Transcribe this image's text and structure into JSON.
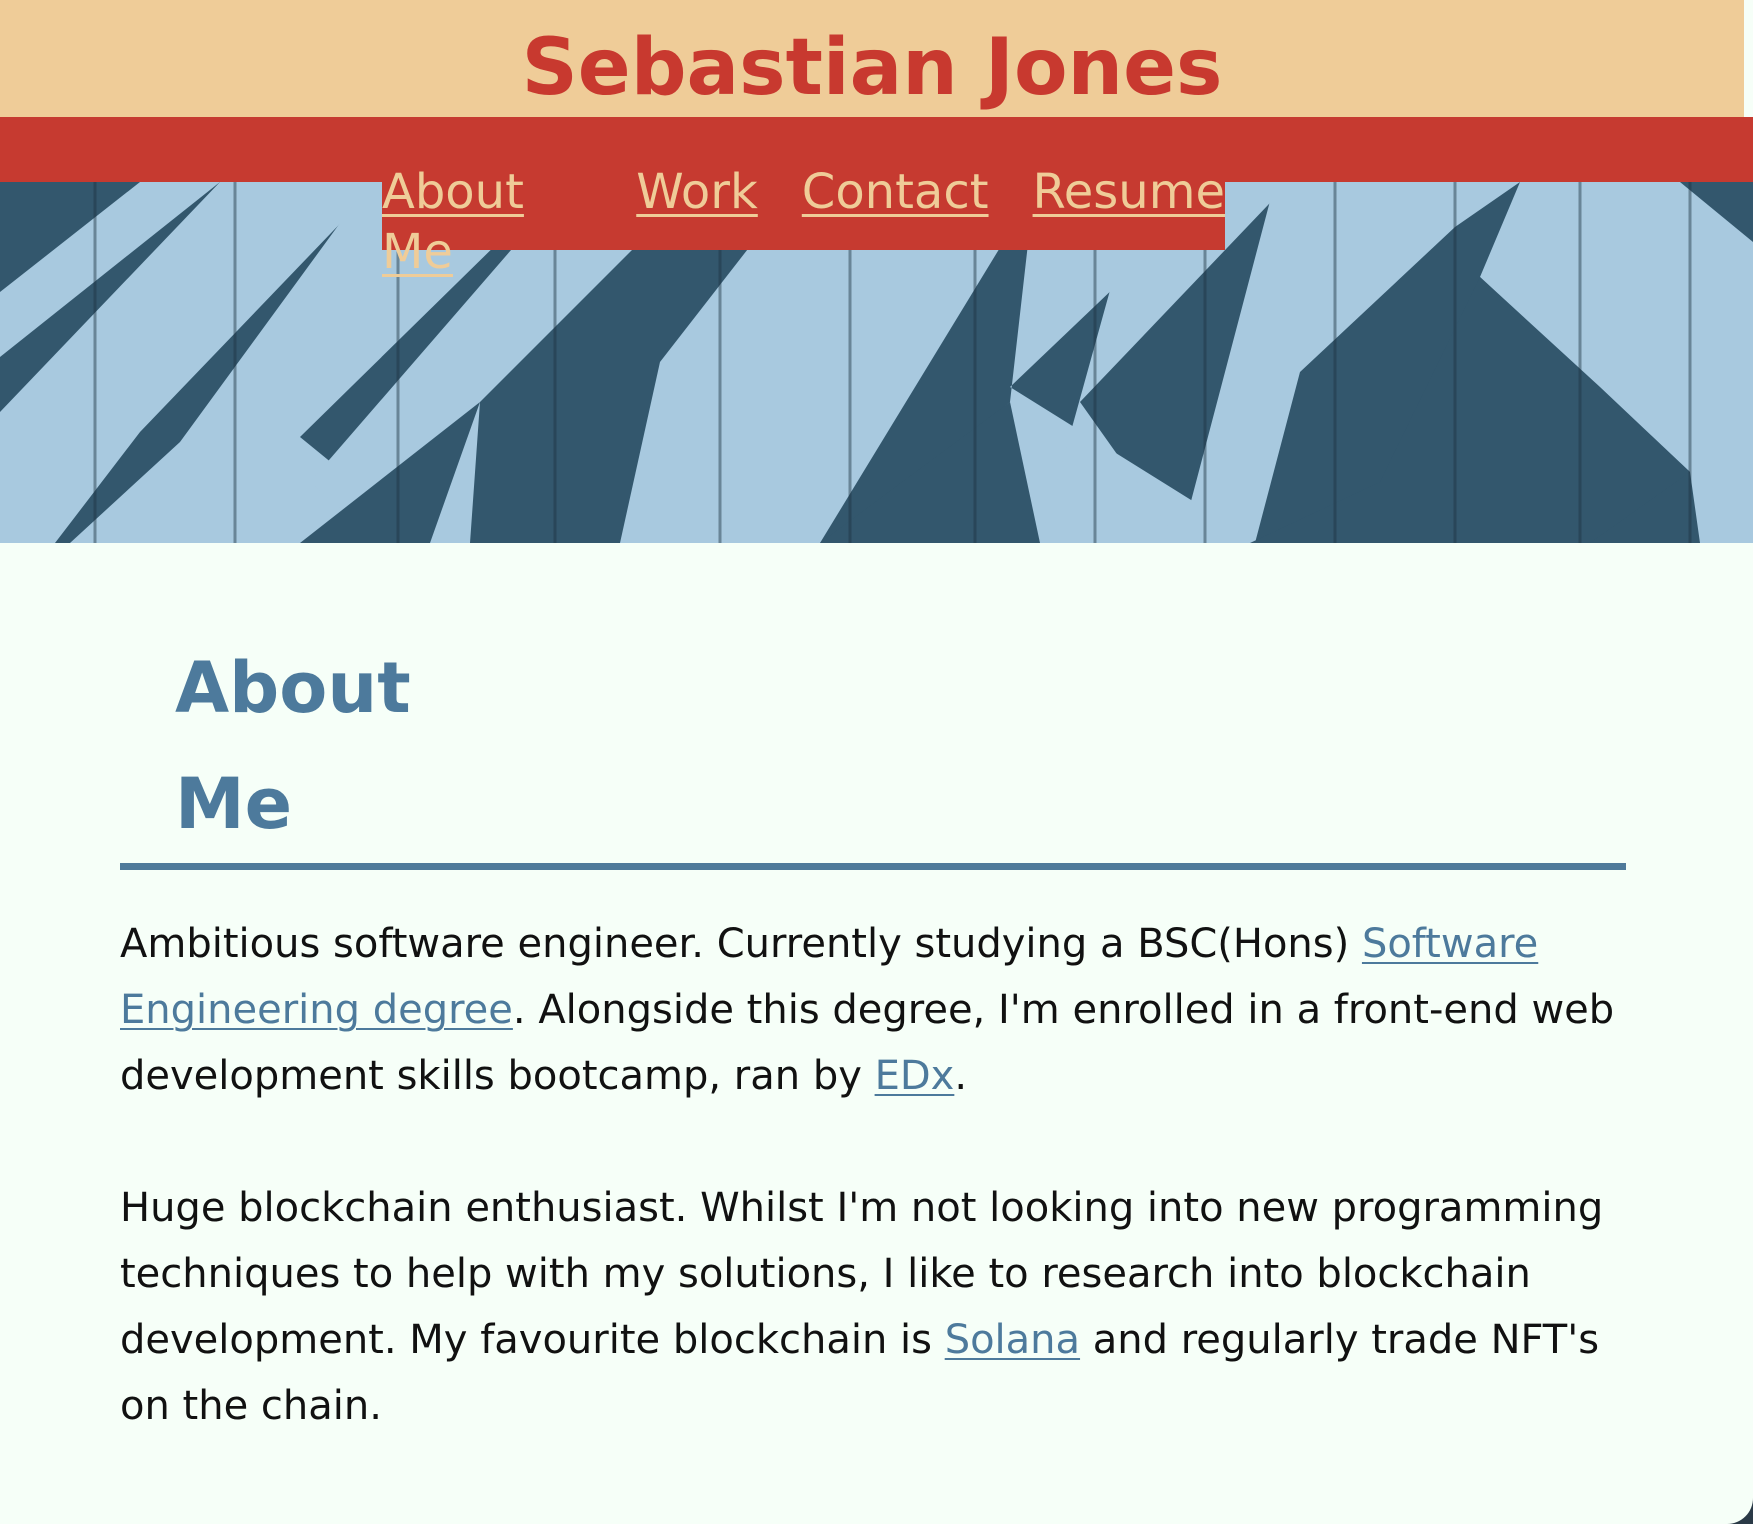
{
  "header": {
    "title": "Sebastian Jones"
  },
  "nav": {
    "items": [
      "About Me",
      "Work",
      "Contact",
      "Resume"
    ]
  },
  "about": {
    "heading": "About Me",
    "paragraph1": {
      "text1": "Ambitious software engineer. Currently studying a BSC(Hons) ",
      "link1": "Software Engineering degree",
      "text2": ". Alongside this degree, I'm enrolled in a front-end web development skills bootcamp, ran by ",
      "link2": "EDx",
      "text3": "."
    },
    "paragraph2": {
      "text1": "Huge blockchain enthusiast. Whilst I'm not looking into new programming techniques to help with my solutions, I like to research into blockchain development. My favourite blockchain is ",
      "link1": "Solana",
      "text2": " and regularly trade NFT's on the chain."
    }
  },
  "colors": {
    "header_background": "#efcc98",
    "accent_red": "#c63a30",
    "link_blue": "#4d7a9c",
    "hero_dark_blue": "#33576d",
    "hero_light_blue": "#a8c9df",
    "page_background": "#f6fff8"
  },
  "icons": {
    "hero_banner": "painted-wooden-chevron-wall-image"
  }
}
